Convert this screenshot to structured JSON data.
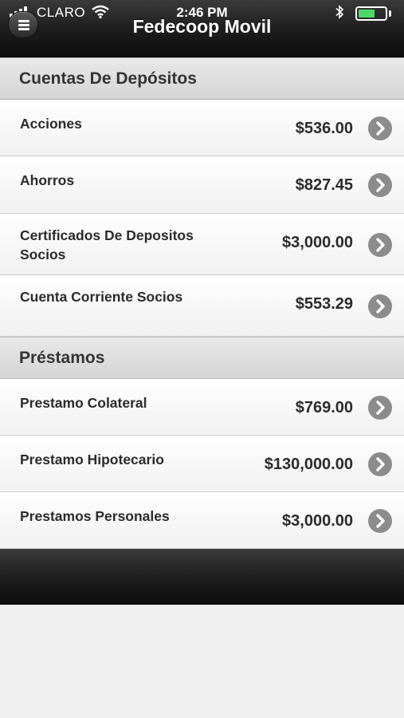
{
  "status_bar": {
    "carrier": "CLARO",
    "time": "2:46 PM"
  },
  "header": {
    "title": "Fedecoop Movil"
  },
  "sections": [
    {
      "title": "Cuentas De Depósitos",
      "rows": [
        {
          "label": "Acciones",
          "amount": "$536.00"
        },
        {
          "label": "Ahorros",
          "amount": "$827.45"
        },
        {
          "label": "Certificados De Depositos Socios",
          "amount": "$3,000.00"
        },
        {
          "label": "Cuenta Corriente Socios",
          "amount": "$553.29"
        }
      ]
    },
    {
      "title": "Préstamos",
      "rows": [
        {
          "label": "Prestamo Colateral",
          "amount": "$769.00"
        },
        {
          "label": "Prestamo Hipotecario",
          "amount": "$130,000.00"
        },
        {
          "label": "Prestamos Personales",
          "amount": "$3,000.00"
        }
      ]
    }
  ],
  "icons": {
    "menu": "hamburger-menu-icon",
    "row_action": "chevron-right-circle-icon",
    "wifi": "wifi-icon",
    "bluetooth": "bluetooth-icon",
    "battery": "battery-icon",
    "signal": "signal-bars-icon"
  },
  "colors": {
    "header_bg": "#1c1c1c",
    "battery_fill": "#4cd964",
    "chevron_bg": "#8c8c8c"
  }
}
